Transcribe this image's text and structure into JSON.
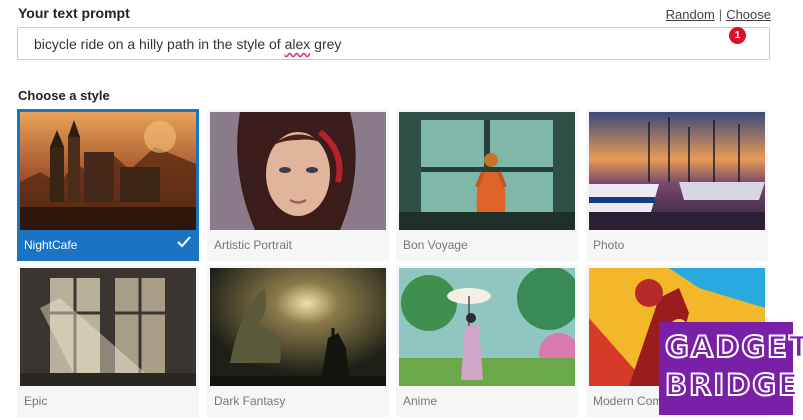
{
  "prompt": {
    "label": "Your text prompt",
    "random_link": "Random",
    "separator": "|",
    "choose_link": "Choose",
    "text_before": "bicycle ride on a hilly path in the style of ",
    "text_misspelled": "alex",
    "text_after": " grey",
    "badge_count": "1"
  },
  "styles": {
    "heading": "Choose a style",
    "tiles": [
      {
        "label": "NightCafe",
        "selected": true
      },
      {
        "label": "Artistic Portrait",
        "selected": false
      },
      {
        "label": "Bon Voyage",
        "selected": false
      },
      {
        "label": "Photo",
        "selected": false
      },
      {
        "label": "Epic",
        "selected": false
      },
      {
        "label": "Dark Fantasy",
        "selected": false
      },
      {
        "label": "Anime",
        "selected": false
      },
      {
        "label": "Modern Com",
        "selected": false
      }
    ]
  },
  "watermark": {
    "line1": "GADGET",
    "line2": "BRIDGE"
  },
  "colors": {
    "selected_accent": "#1b73c4",
    "badge": "#d6122d",
    "watermark_bg": "#7a1fa8"
  }
}
